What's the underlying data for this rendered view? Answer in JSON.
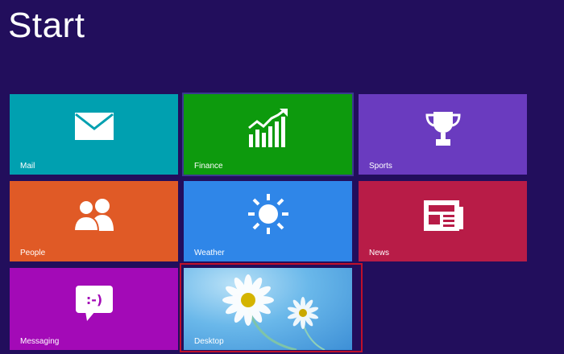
{
  "header": {
    "title": "Start"
  },
  "tiles": {
    "mail": {
      "label": "Mail",
      "color": "#00a0b0",
      "icon": "mail-icon"
    },
    "finance": {
      "label": "Finance",
      "color": "#0d9a0d",
      "icon": "finance-chart-icon"
    },
    "sports": {
      "label": "Sports",
      "color": "#6a3bbf",
      "icon": "trophy-icon"
    },
    "people": {
      "label": "People",
      "color": "#e05a26",
      "icon": "people-icon"
    },
    "weather": {
      "label": "Weather",
      "color": "#2f86e8",
      "icon": "sun-icon"
    },
    "news": {
      "label": "News",
      "color": "#b81c47",
      "icon": "newspaper-icon"
    },
    "messaging": {
      "label": "Messaging",
      "color": "#a30ab7",
      "icon": "chat-bubble-icon"
    },
    "desktop": {
      "label": "Desktop",
      "color": "#4fa3e0",
      "icon": "daisy-wallpaper"
    }
  },
  "selection": {
    "highlight_color": "#c0102a",
    "selected_tile": "Desktop"
  }
}
